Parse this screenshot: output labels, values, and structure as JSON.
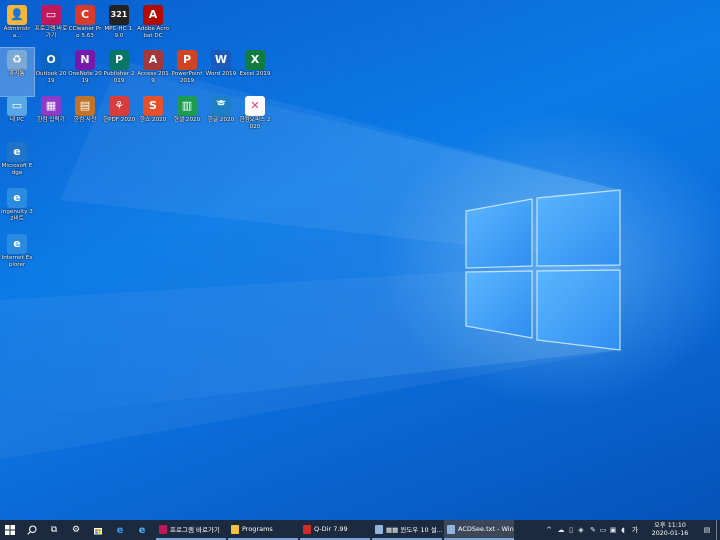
{
  "desktop": {
    "icons": [
      {
        "label": "Administra...",
        "icon": "user-folder-icon",
        "color": "#f3b53a",
        "glyph": "👤"
      },
      {
        "label": "프로그램 바로가기",
        "icon": "tv-shortcut-icon",
        "color": "#c2185b",
        "glyph": "▭"
      },
      {
        "label": "CCleaner Pro 5.63",
        "icon": "ccleaner-icon",
        "color": "#d83b2b",
        "glyph": "C"
      },
      {
        "label": "MPC-HC 1.9.0",
        "icon": "mpc-hc-icon",
        "color": "#222222",
        "glyph": "321"
      },
      {
        "label": "Adobe Acrobat DC",
        "icon": "acrobat-icon",
        "color": "#b30b00",
        "glyph": "A"
      },
      {
        "label": "휴지통",
        "icon": "recycle-bin-icon",
        "color": "#7aa9d6",
        "glyph": "♻"
      },
      {
        "label": "Outlook 2019",
        "icon": "outlook-icon",
        "color": "#0a64c4",
        "glyph": "O"
      },
      {
        "label": "OneNote 2019",
        "icon": "onenote-icon",
        "color": "#7719aa",
        "glyph": "N"
      },
      {
        "label": "Publisher 2019",
        "icon": "publisher-icon",
        "color": "#077568",
        "glyph": "P"
      },
      {
        "label": "Access 2019",
        "icon": "access-icon",
        "color": "#a4373a",
        "glyph": "A"
      },
      {
        "label": "PowerPoint 2019",
        "icon": "powerpoint-icon",
        "color": "#d04423",
        "glyph": "P"
      },
      {
        "label": "Word 2019",
        "icon": "word-icon",
        "color": "#185abd",
        "glyph": "W"
      },
      {
        "label": "Excel 2019",
        "icon": "excel-icon",
        "color": "#107c41",
        "glyph": "X"
      },
      {
        "label": "내 PC",
        "icon": "this-pc-icon",
        "color": "#5aa7e6",
        "glyph": "▭"
      },
      {
        "label": "한컴 입력기",
        "icon": "hancom-input-icon",
        "color": "#8e3bc8",
        "glyph": "▦"
      },
      {
        "label": "한컴 사전",
        "icon": "hancom-dictionary-icon",
        "color": "#c0742a",
        "glyph": "▤"
      },
      {
        "label": "한PDF 2020",
        "icon": "hancom-pdf-icon",
        "color": "#d93c3c",
        "glyph": "⚘"
      },
      {
        "label": "한쇼 2020",
        "icon": "hancom-show-icon",
        "color": "#e4512b",
        "glyph": "S"
      },
      {
        "label": "한셀 2020",
        "icon": "hancom-cell-icon",
        "color": "#1c9c52",
        "glyph": "▥"
      },
      {
        "label": "한글 2020",
        "icon": "hancom-hangul-icon",
        "color": "#1d7fc6",
        "glyph": "ᄒ"
      },
      {
        "label": "한컴오피스 2020",
        "icon": "hancom-office-icon",
        "color": "#ffffff",
        "glyph": "✕"
      },
      {
        "label": "Microsoft Edge",
        "icon": "edge-icon",
        "color": "#1f74c9",
        "glyph": "e"
      },
      {
        "label": "Ingenuity 32비트",
        "icon": "internet-explorer-32bit-icon",
        "color": "#2a8be0",
        "glyph": "e"
      },
      {
        "label": "Internet Explorer",
        "icon": "internet-explorer-icon",
        "color": "#2a8be0",
        "glyph": "e"
      }
    ]
  },
  "taskbar": {
    "start_icon": "windows-start-icon",
    "search_icon": "search-icon",
    "pinned": [
      {
        "icon": "task-view-icon",
        "glyph": "⧉"
      },
      {
        "icon": "store-icon",
        "glyph": "🛍"
      },
      {
        "icon": "settings-gear-icon",
        "glyph": "⚙"
      },
      {
        "icon": "edge-icon",
        "glyph": "e"
      },
      {
        "icon": "internet-explorer-icon",
        "glyph": "e"
      }
    ],
    "tasks": [
      {
        "label": "프로그램 바로가기",
        "icon": "tv-shortcut-icon",
        "color": "#c2185b"
      },
      {
        "label": "Programs",
        "icon": "folder-icon",
        "color": "#f3c33d"
      },
      {
        "label": "Q-Dir 7.99",
        "icon": "qdir-icon",
        "color": "#d12b2b"
      },
      {
        "label": "▦▦ 윈도우 10 설...",
        "icon": "notepad-icon",
        "color": "#8fb4de"
      },
      {
        "label": "ACDSee.txt - Wind...",
        "icon": "notepad-icon",
        "color": "#8fb4de"
      }
    ],
    "tray": {
      "chevron": "^",
      "ime": "가",
      "icons": [
        "onedrive-icon",
        "network-icon",
        "volume-icon",
        "keyboard-icon",
        "shield-icon",
        "tools-icon",
        "display-icon"
      ]
    },
    "clock": {
      "time": "오후 11:10",
      "date": "2020-01-16"
    }
  }
}
